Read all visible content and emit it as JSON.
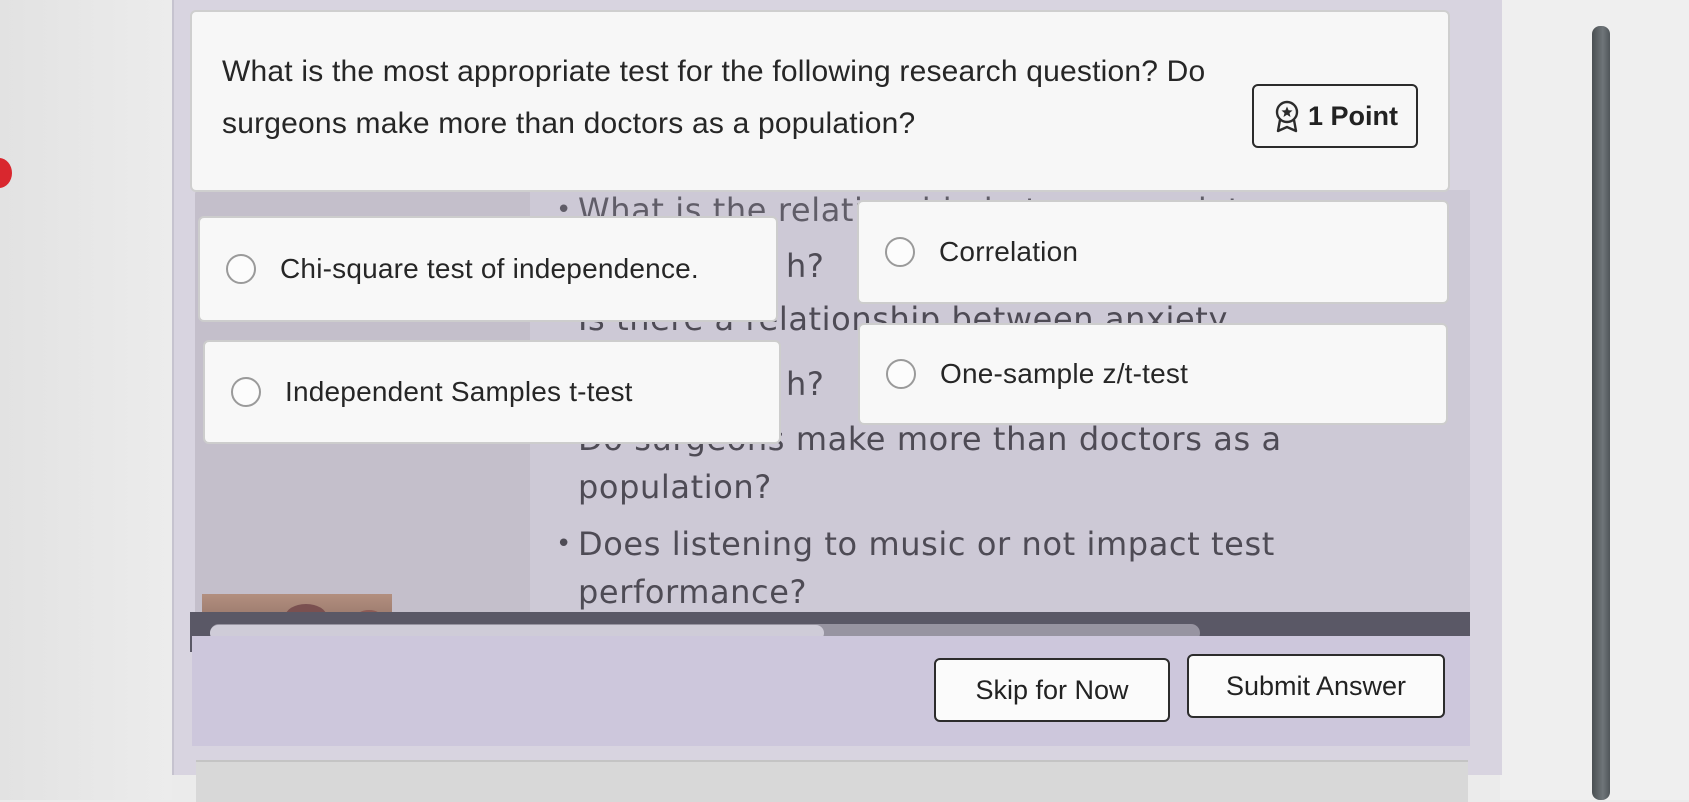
{
  "question": {
    "text": "What is the most appropriate test for the following research question? Do surgeons make more than doctors as a population?",
    "points_label": "1 Point",
    "points_icon": "award-ribbon-icon"
  },
  "options": [
    {
      "label": "Chi-square test of independence.",
      "selected": false
    },
    {
      "label": "Correlation",
      "selected": false
    },
    {
      "label": "Independent Samples t-test",
      "selected": false
    },
    {
      "label": "One-sample z/t-test",
      "selected": false
    }
  ],
  "background_slide": {
    "bullets": [
      "What is the relationship between anxiety and",
      "Is there a relationship between anxiety and",
      "Do surgeons make more than doctors as a population?",
      "Does listening to music or not impact test performance?"
    ],
    "fragments": [
      "h?",
      "h?"
    ]
  },
  "video_progress": 0.62,
  "buttons": {
    "skip": "Skip for Now",
    "submit": "Submit Answer"
  },
  "colors": {
    "card_background": "#d8d4e0",
    "button_border": "#2c2c2c",
    "accent_red": "#d9272e"
  }
}
